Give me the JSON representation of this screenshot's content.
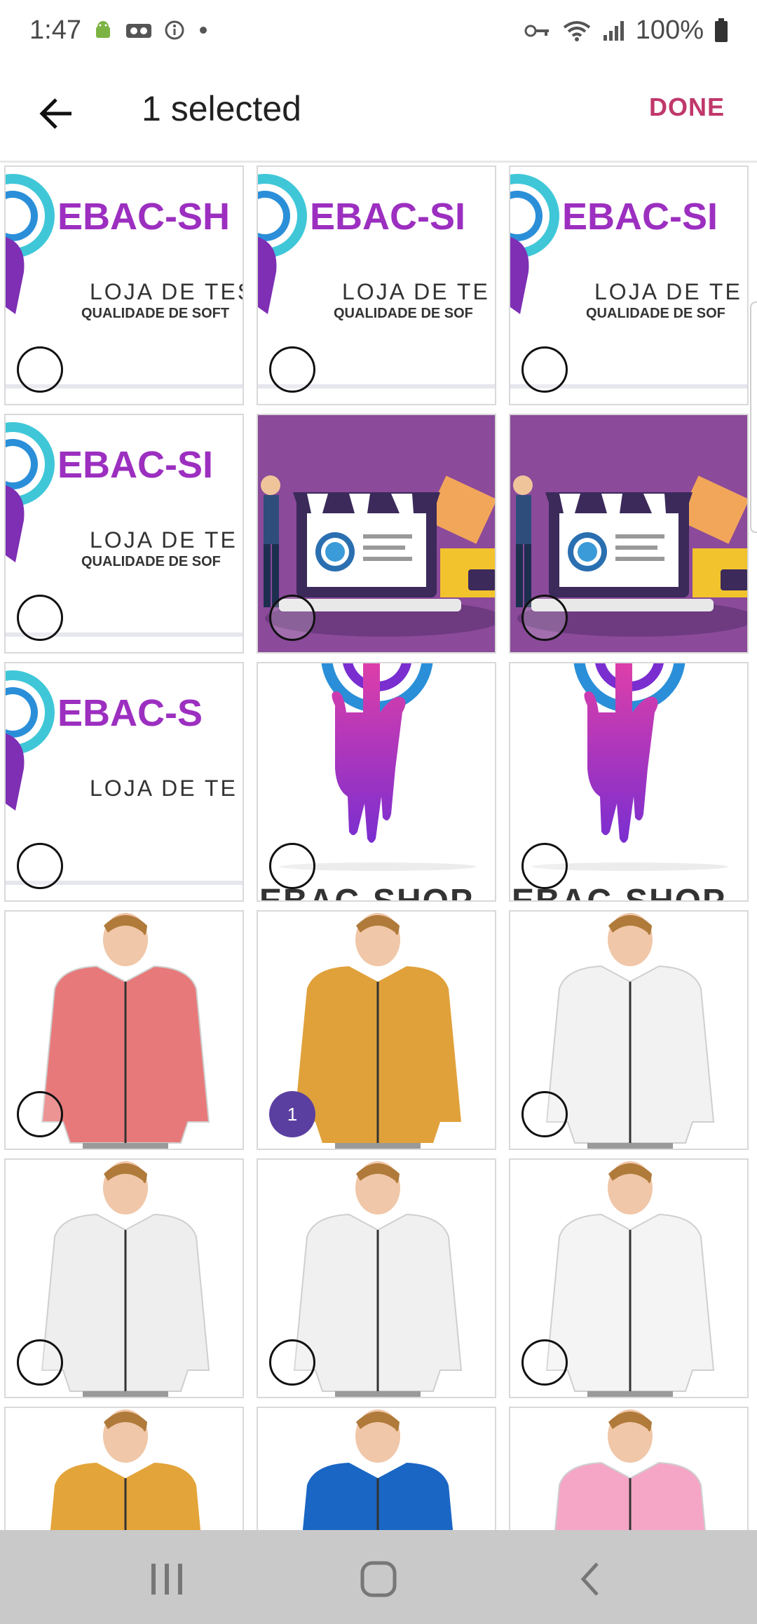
{
  "status": {
    "time": "1:47",
    "battery": "100%",
    "left_icons": [
      "android-icon",
      "voicemail-icon",
      "info-icon",
      "dot-icon"
    ],
    "right_icons": [
      "vpn-key-icon",
      "wifi-icon",
      "signal-icon",
      "battery-icon"
    ]
  },
  "header": {
    "title": "1 selected",
    "done_label": "DONE"
  },
  "colors": {
    "accent": "#c0386b",
    "badge": "#5b3fa0",
    "logo": "#9c2fc0",
    "promo_bg": "#8b4a9a"
  },
  "grid": {
    "cells": [
      {
        "kind": "logo",
        "text": "EBAC-SH",
        "loja": "LOJA DE TES",
        "qual": "QUALIDADE DE SOFT",
        "selected": false
      },
      {
        "kind": "logo",
        "text": "EBAC-SI",
        "loja": "LOJA DE TE",
        "qual": "QUALIDADE DE SOF",
        "selected": false
      },
      {
        "kind": "logo",
        "text": "EBAC-SI",
        "loja": "LOJA DE TE",
        "qual": "QUALIDADE DE SOF",
        "selected": false
      },
      {
        "kind": "logo",
        "text": "EBAC-SI",
        "loja": "LOJA DE TE",
        "qual": "QUALIDADE DE SOF",
        "selected": false
      },
      {
        "kind": "promo",
        "selected": false
      },
      {
        "kind": "promo",
        "selected": false
      },
      {
        "kind": "logo",
        "text": "EBAC-S",
        "loja": "LOJA DE TE",
        "qual": "",
        "selected": false
      },
      {
        "kind": "hand",
        "caption": "EBAC-SHOP",
        "selected": false
      },
      {
        "kind": "hand",
        "caption": "EBAC-SHOP",
        "selected": false
      },
      {
        "kind": "jacket",
        "jacket_color": "#e8797a",
        "selected": false
      },
      {
        "kind": "jacket",
        "jacket_color": "#e0a13b",
        "selected": true,
        "badge": "1"
      },
      {
        "kind": "jacket",
        "jacket_color": "#f2f2f2",
        "selected": false
      },
      {
        "kind": "jacket",
        "jacket_color": "#eeeeee",
        "selected": false
      },
      {
        "kind": "jacket",
        "jacket_color": "#f0f0f0",
        "selected": false
      },
      {
        "kind": "jacket",
        "jacket_color": "#f4f4f4",
        "selected": false
      },
      {
        "kind": "jacket",
        "jacket_color": "#e3a43a",
        "selected": false
      },
      {
        "kind": "jacket",
        "jacket_color": "#1a66c4",
        "selected": false
      },
      {
        "kind": "jacket",
        "jacket_color": "#f5a6c6",
        "selected": false
      }
    ]
  }
}
